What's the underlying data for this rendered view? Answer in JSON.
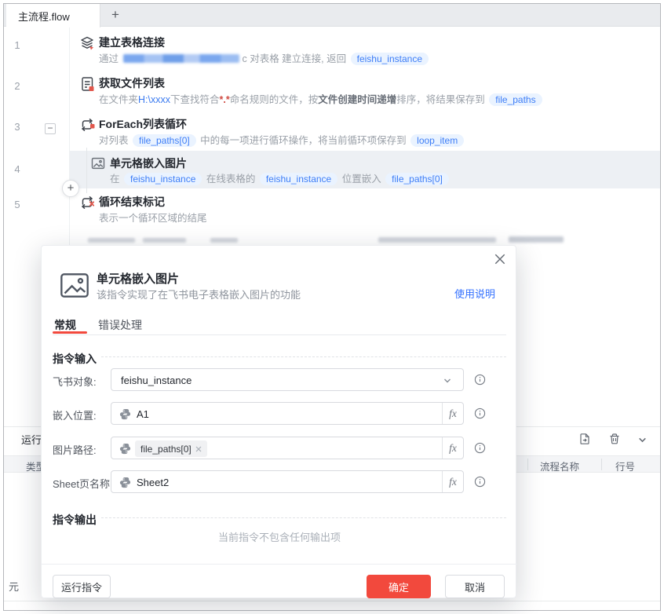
{
  "colors": {
    "accent_red": "#f2493d",
    "link_blue": "#3370ff",
    "chip_blue_bg": "#eaf3ff",
    "chip_blue_text": "#3e7ef7"
  },
  "tabbar": {
    "active_tab": "主流程.flow",
    "new_tab_glyph": "+"
  },
  "flow": {
    "collapse_glyph": "−",
    "add_glyph": "+",
    "steps": [
      {
        "num": "1",
        "icon": "layers-icon",
        "title": "建立表格连接",
        "desc": [
          {
            "s": "plain",
            "t": "通过 "
          },
          {
            "s": "redacted"
          },
          {
            "s": "plain",
            "t": "c 对表格 建立连接, 返回 "
          },
          {
            "s": "chip",
            "t": "feishu_instance"
          }
        ]
      },
      {
        "num": "2",
        "icon": "document-icon",
        "title": "获取文件列表",
        "desc": [
          {
            "s": "plain",
            "t": "在文件夹"
          },
          {
            "s": "blue",
            "t": "H:\\xxxx"
          },
          {
            "s": "plain",
            "t": "下查找符合"
          },
          {
            "s": "red",
            "t": "*.*"
          },
          {
            "s": "plain",
            "t": "命名规则的文件，按"
          },
          {
            "s": "bold",
            "t": "文件创建时间递增"
          },
          {
            "s": "plain",
            "t": "排序，将结果保存到 "
          },
          {
            "s": "chip",
            "t": "file_paths"
          }
        ]
      },
      {
        "num": "3",
        "icon": "loop-icon",
        "title": "ForEach列表循环",
        "desc": [
          {
            "s": "plain",
            "t": "对列表 "
          },
          {
            "s": "chip",
            "t": "file_paths[0]"
          },
          {
            "s": "plain",
            "t": " 中的每一项进行循环操作，将当前循环项保存到 "
          },
          {
            "s": "chip",
            "t": "loop_item"
          }
        ]
      },
      {
        "num": "4",
        "icon": "image-icon",
        "title": "单元格嵌入图片",
        "highlighted": true,
        "desc": [
          {
            "s": "plain",
            "t": "在 "
          },
          {
            "s": "chip",
            "t": "feishu_instance"
          },
          {
            "s": "plain",
            "t": " 在线表格的 "
          },
          {
            "s": "chip",
            "t": "feishu_instance"
          },
          {
            "s": "plain",
            "t": " 位置嵌入 "
          },
          {
            "s": "chip",
            "t": "file_paths[0]"
          }
        ]
      },
      {
        "num": "5",
        "icon": "loop-end-icon",
        "title": "循环结束标记",
        "desc": [
          {
            "s": "plain",
            "t": "表示一个循环区域的结尾"
          }
        ]
      }
    ]
  },
  "panel": {
    "title": "运行",
    "columns": [
      "类型",
      "流程名称",
      "行号"
    ],
    "icons": [
      "export-log-icon",
      "clear-log-icon",
      "collapse-panel-icon"
    ],
    "bottom_left": "元"
  },
  "dialog": {
    "title": "单元格嵌入图片",
    "subtitle": "该指令实现了在飞书电子表格嵌入图片的功能",
    "help_link": "使用说明",
    "tabs": [
      {
        "label": "常规",
        "active": true
      },
      {
        "label": "错误处理",
        "active": false
      }
    ],
    "input_section": "指令输入",
    "output_section": "指令输出",
    "output_empty": "当前指令不包含任何输出项",
    "fx_label": "fx",
    "fields": [
      {
        "label": "飞书对象:",
        "type": "select",
        "value": "feishu_instance"
      },
      {
        "label": "嵌入位置:",
        "type": "python-input",
        "value": "A1"
      },
      {
        "label": "图片路径:",
        "type": "python-chip-input",
        "chip": "file_paths[0]"
      },
      {
        "label": "Sheet页名称:",
        "type": "python-input",
        "value": "Sheet2"
      }
    ],
    "buttons": {
      "run": "运行指令",
      "ok": "确定",
      "cancel": "取消"
    }
  }
}
